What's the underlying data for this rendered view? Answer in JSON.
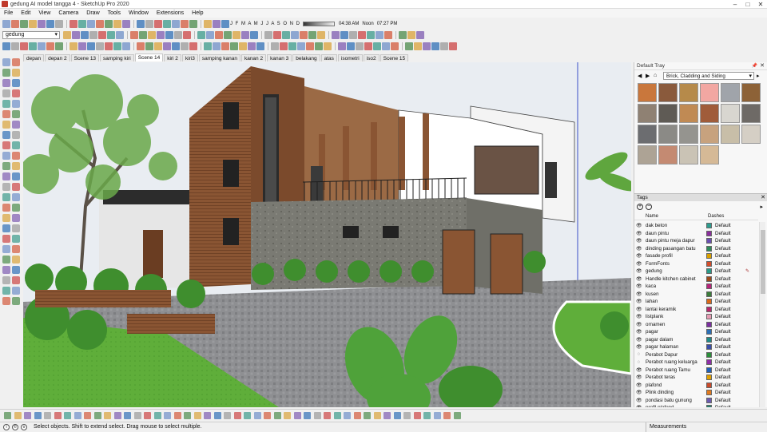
{
  "window": {
    "title": "gedung AI model tangga 4 - SketchUp Pro 2020"
  },
  "menubar": {
    "items": [
      "File",
      "Edit",
      "View",
      "Camera",
      "Draw",
      "Tools",
      "Window",
      "Extensions",
      "Help"
    ]
  },
  "toolbar": {
    "tag_selector": {
      "value": "gedung"
    },
    "shadow_months": "J F M A M J J A S O N D",
    "time_start": "04:38 AM",
    "time_noon": "Noon",
    "time_end": "07:27 PM"
  },
  "scene_tabs": [
    "depan",
    "depan 2",
    "Scene 13",
    "samping kiri",
    "Scene 14",
    "kiri 2",
    "kiri3",
    "samping kanan",
    "kanan 2",
    "kanan 3",
    "belakang",
    "atas",
    "isometri",
    "iso2",
    "Scene 15"
  ],
  "active_scene_index": 4,
  "tray": {
    "title": "Default Tray",
    "materials": {
      "library": "Brick, Cladding and Siding",
      "swatch_colors": [
        "#c9773c",
        "#8a5a3c",
        "#b68a4a",
        "#f2a7a2",
        "#a0a4aa",
        "#8d6237",
        "#8f8173",
        "#5f5b55",
        "#c08a54",
        "#a05c3a",
        "#d8d6d0",
        "#6e6a66",
        "#6c6d70",
        "#8b8a86",
        "#95948f",
        "#c7a27e",
        "#c8bea8",
        "#d5cfc5",
        "#ada395",
        "#c48a72",
        "#cac3b5",
        "#d5b996"
      ]
    },
    "tags": {
      "title": "Tags",
      "col_name": "Name",
      "col_dashes": "Dashes",
      "rows": [
        {
          "name": "dak beton",
          "color": "#2e9c8e",
          "dash": "Default",
          "visible": true
        },
        {
          "name": "daun pintu",
          "color": "#8a2f9c",
          "dash": "Default",
          "visible": true
        },
        {
          "name": "daun pintu meja dapur",
          "color": "#6a4fb0",
          "dash": "Default",
          "visible": true
        },
        {
          "name": "dinding pasangan batu",
          "color": "#2e8a5a",
          "dash": "Default",
          "visible": true
        },
        {
          "name": "fasade profil",
          "color": "#d9a000",
          "dash": "Default",
          "visible": true
        },
        {
          "name": "FormFonts",
          "color": "#d24d2b",
          "dash": "Default",
          "visible": true
        },
        {
          "name": "gedung",
          "color": "#2a9a88",
          "dash": "Default",
          "visible": true
        },
        {
          "name": "Handle kitchen cabinet",
          "color": "#9c4a1c",
          "dash": "Default",
          "visible": true
        },
        {
          "name": "kaca",
          "color": "#b6257a",
          "dash": "Default",
          "visible": true
        },
        {
          "name": "kusen",
          "color": "#3b7d3b",
          "dash": "Default",
          "visible": true
        },
        {
          "name": "lahan",
          "color": "#d96a1a",
          "dash": "Default",
          "visible": true
        },
        {
          "name": "lantai keramik",
          "color": "#b8276c",
          "dash": "Default",
          "visible": true
        },
        {
          "name": "listplank",
          "color": "#e59bb3",
          "dash": "Default",
          "visible": true
        },
        {
          "name": "ornamen",
          "color": "#7b2fa0",
          "dash": "Default",
          "visible": true
        },
        {
          "name": "pagar",
          "color": "#2c6fb5",
          "dash": "Default",
          "visible": true
        },
        {
          "name": "pagar dalam",
          "color": "#1f8a87",
          "dash": "Default",
          "visible": true
        },
        {
          "name": "pagar halaman",
          "color": "#3a4ea8",
          "dash": "Default",
          "visible": true
        },
        {
          "name": "Perabot Dapur",
          "color": "#2b8e3a",
          "dash": "Default",
          "visible": false
        },
        {
          "name": "Perabot ruang keluarga",
          "color": "#8e2fa6",
          "dash": "Default",
          "visible": false
        },
        {
          "name": "Perabot ruang Tamu",
          "color": "#2060b8",
          "dash": "Default",
          "visible": true
        },
        {
          "name": "Perabot teras",
          "color": "#e0a000",
          "dash": "Default",
          "visible": true
        },
        {
          "name": "plafond",
          "color": "#c94a2b",
          "dash": "Default",
          "visible": true
        },
        {
          "name": "Plink dinding",
          "color": "#e07a1e",
          "dash": "Default",
          "visible": true
        },
        {
          "name": "pondasi batu gunung",
          "color": "#6b5bb0",
          "dash": "Default",
          "visible": true
        },
        {
          "name": "profil plafond",
          "color": "#2e7d6e",
          "dash": "Default",
          "visible": true
        }
      ]
    }
  },
  "status": {
    "hint": "Select objects. Shift to extend select. Drag mouse to select multiple.",
    "measurements_label": "Measurements"
  },
  "colors": {
    "accent": "#2f6fb6",
    "sky": "#e9edf2",
    "grass": "#5fae3a"
  }
}
